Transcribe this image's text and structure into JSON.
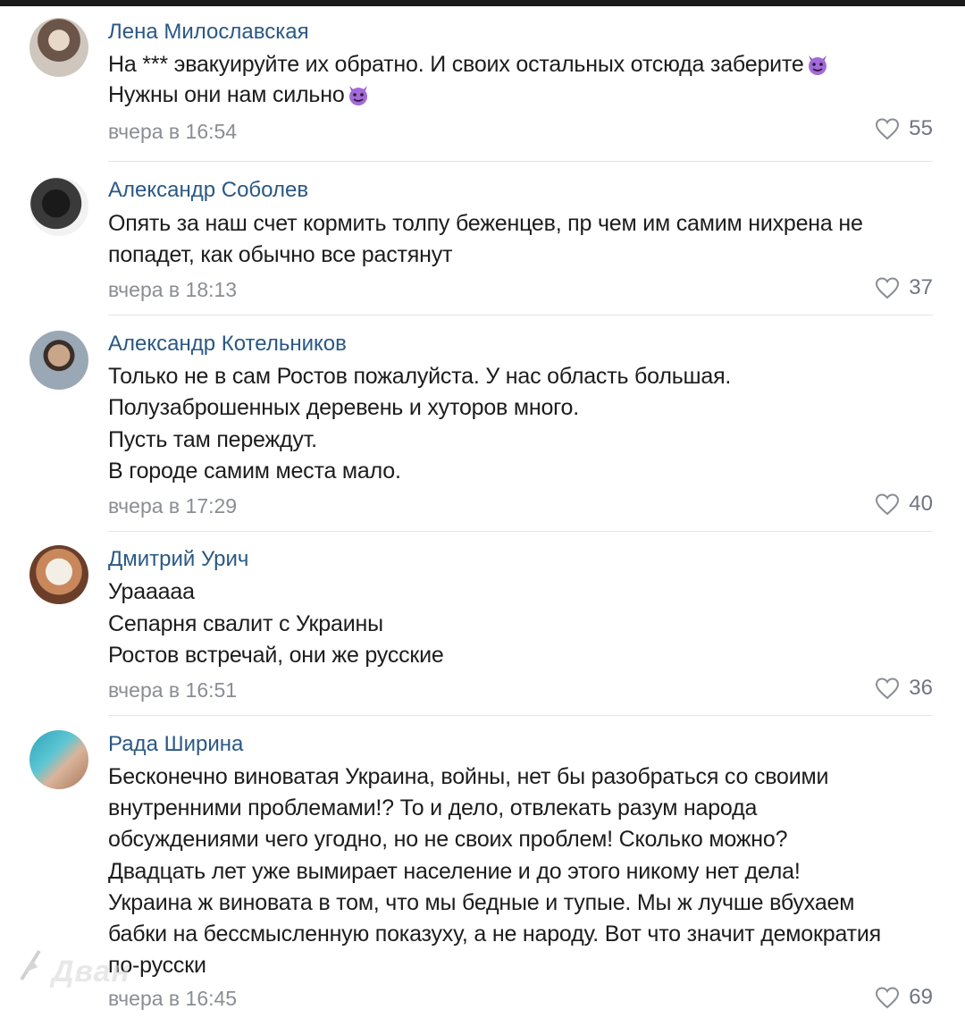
{
  "comments": [
    {
      "author": "Лена Милославская",
      "lines": [
        "На *** эвакуируйте их обратно. И своих остальных отсюда заберите",
        "Нужны они нам сильно"
      ],
      "emoji": "smiling-imp-emoji",
      "time": "вчера в 16:54",
      "likes": "55"
    },
    {
      "author": "Александр Соболев",
      "lines": [
        "Опять за наш счет кормить толпу беженцев, пр чем им самим нихрена не",
        "попадет, как обычно все растянут"
      ],
      "time": "вчера в 18:13",
      "likes": "37"
    },
    {
      "author": "Александр Котельников",
      "lines": [
        "Только не в сам Ростов пожалуйста. У нас область большая.",
        "Полузаброшенных деревень и хуторов много.",
        "Пусть там переждут.",
        "В городе самим места мало."
      ],
      "time": "вчера в 17:29",
      "likes": "40"
    },
    {
      "author": "Дмитрий Урич",
      "lines": [
        "Урааааа",
        "Сепарня свалит с Украины",
        "Ростов встречай, они же русские"
      ],
      "time": "вчера в 16:51",
      "likes": "36"
    },
    {
      "author": "Рада Ширина",
      "lines": [
        "Бесконечно виноватая Украина, войны, нет бы разобраться со своими",
        "внутренними проблемами!? То и дело, отвлекать разум народа",
        "обсуждениями чего угодно, но не своих проблем! Сколько можно?",
        "Двадцать лет уже вымирает население и до этого никому нет дела!",
        "Украина ж виновата в том, что мы бедные и тупые. Мы ж лучше вбухаем",
        "бабки на бессмысленную показуху, а не народу. Вот что значит демократия",
        "по-русски"
      ],
      "time": "вчера в 16:45",
      "likes": "69"
    }
  ],
  "watermark": "Дван",
  "colors": {
    "author": "#2a5885",
    "text": "#1c1c1c",
    "meta": "#8a8e93",
    "like": "#6f7680",
    "divider": "#e3e4e6",
    "emoji": "#9b59d0"
  }
}
